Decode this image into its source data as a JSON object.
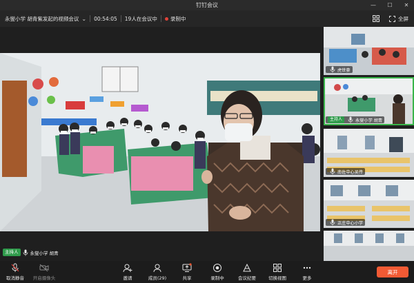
{
  "window": {
    "title": "钉钉会议",
    "fullscreen_label": "全屏"
  },
  "infobar": {
    "meeting_name": "永燮小学  胡青紫发起的视频会议",
    "duration": "00:54:05",
    "participants_status": "19人在会议中",
    "recording_status": "录制中"
  },
  "main_video": {
    "host_badge": "主持人",
    "speaker_name": "永燮小学  胡青"
  },
  "thumbnails": [
    {
      "name": "虎世豪",
      "host": false
    },
    {
      "name": "永燮小学  胡青",
      "host": true,
      "host_badge": "主持人"
    },
    {
      "name": "南佐中心吴传",
      "host": false
    },
    {
      "name": "正庄中心小学",
      "host": false
    },
    {
      "name": "",
      "host": false
    }
  ],
  "toolbar": {
    "mute_label": "取消静音",
    "camera_label": "开启摄像头",
    "invite_label": "邀请",
    "members_label": "成员(29)",
    "share_label": "共享",
    "record_label": "录制中",
    "minutes_label": "会议纪要",
    "switch_view_label": "切换视图",
    "more_label": "更多",
    "leave_label": "离开"
  },
  "icons": {
    "minimize": "minimize-icon",
    "maximize": "maximize-icon",
    "close": "close-icon",
    "fullscreen": "fullscreen-icon",
    "microphone": "microphone-icon",
    "camera": "camera-icon"
  },
  "colors": {
    "host_green": "#2f9b4b",
    "active_border": "#39b54a",
    "leave": "#f25a34",
    "record": "#e0433a"
  }
}
